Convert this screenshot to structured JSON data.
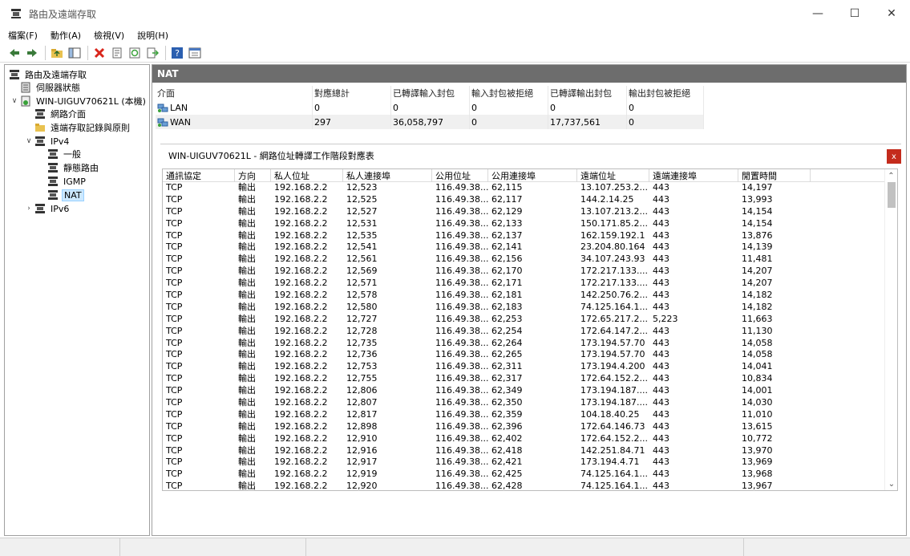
{
  "window": {
    "title": "路由及遠端存取",
    "minimize": "—",
    "maximize": "☐",
    "close": "✕"
  },
  "menu": [
    "檔案(F)",
    "動作(A)",
    "檢視(V)",
    "說明(H)"
  ],
  "tree": [
    {
      "label": "路由及遠端存取",
      "level": 0,
      "exp": "",
      "icon": "server-icon"
    },
    {
      "label": "伺服器狀態",
      "level": 1,
      "exp": "",
      "icon": "server-status-icon"
    },
    {
      "label": "WIN-UIGUV70621L (本機)",
      "level": 1,
      "exp": "∨",
      "icon": "computer-icon"
    },
    {
      "label": "網路介面",
      "level": 2,
      "exp": "",
      "icon": "network-icon"
    },
    {
      "label": "遠端存取記錄與原則",
      "level": 2,
      "exp": "",
      "icon": "folder-icon"
    },
    {
      "label": "IPv4",
      "level": 2,
      "exp": "∨",
      "icon": "network-icon"
    },
    {
      "label": "一般",
      "level": 3,
      "exp": "",
      "icon": "network-icon"
    },
    {
      "label": "靜態路由",
      "level": 3,
      "exp": "",
      "icon": "network-icon"
    },
    {
      "label": "IGMP",
      "level": 3,
      "exp": "",
      "icon": "network-icon"
    },
    {
      "label": "NAT",
      "level": 3,
      "exp": "",
      "icon": "network-icon",
      "selected": true
    },
    {
      "label": "IPv6",
      "level": 2,
      "exp": "›",
      "icon": "network-icon"
    }
  ],
  "nat": {
    "header": "NAT",
    "columns": [
      "介面",
      "對應總計",
      "已轉譯輸入封包",
      "輸入封包被拒絕",
      "已轉譯輸出封包",
      "輸出封包被拒絕"
    ],
    "rows": [
      [
        "LAN",
        "0",
        "0",
        "0",
        "0",
        "0"
      ],
      [
        "WAN",
        "297",
        "36,058,797",
        "0",
        "17,737,561",
        "0"
      ]
    ]
  },
  "mapping": {
    "title": "WIN-UIGUV70621L - 網路位址轉譯工作階段對應表",
    "close": "x",
    "columns": [
      "通訊協定",
      "方向",
      "私人位址",
      "私人連接埠",
      "公用位址",
      "公用連接埠",
      "遠端位址",
      "遠端連接埠",
      "閒置時間"
    ],
    "rows": [
      [
        "TCP",
        "輸出",
        "192.168.2.2",
        "12,523",
        "116.49.38...",
        "62,115",
        "13.107.253.2...",
        "443",
        "14,197"
      ],
      [
        "TCP",
        "輸出",
        "192.168.2.2",
        "12,525",
        "116.49.38...",
        "62,117",
        "144.2.14.25",
        "443",
        "13,993"
      ],
      [
        "TCP",
        "輸出",
        "192.168.2.2",
        "12,527",
        "116.49.38...",
        "62,129",
        "13.107.213.2...",
        "443",
        "14,154"
      ],
      [
        "TCP",
        "輸出",
        "192.168.2.2",
        "12,531",
        "116.49.38...",
        "62,133",
        "150.171.85.2...",
        "443",
        "14,154"
      ],
      [
        "TCP",
        "輸出",
        "192.168.2.2",
        "12,535",
        "116.49.38...",
        "62,137",
        "162.159.192.1",
        "443",
        "13,876"
      ],
      [
        "TCP",
        "輸出",
        "192.168.2.2",
        "12,541",
        "116.49.38...",
        "62,141",
        "23.204.80.164",
        "443",
        "14,139"
      ],
      [
        "TCP",
        "輸出",
        "192.168.2.2",
        "12,561",
        "116.49.38...",
        "62,156",
        "34.107.243.93",
        "443",
        "11,481"
      ],
      [
        "TCP",
        "輸出",
        "192.168.2.2",
        "12,569",
        "116.49.38...",
        "62,170",
        "172.217.133....",
        "443",
        "14,207"
      ],
      [
        "TCP",
        "輸出",
        "192.168.2.2",
        "12,571",
        "116.49.38...",
        "62,171",
        "172.217.133....",
        "443",
        "14,207"
      ],
      [
        "TCP",
        "輸出",
        "192.168.2.2",
        "12,578",
        "116.49.38...",
        "62,181",
        "142.250.76.2...",
        "443",
        "14,182"
      ],
      [
        "TCP",
        "輸出",
        "192.168.2.2",
        "12,580",
        "116.49.38...",
        "62,183",
        "74.125.164.1...",
        "443",
        "14,182"
      ],
      [
        "TCP",
        "輸出",
        "192.168.2.2",
        "12,727",
        "116.49.38...",
        "62,253",
        "172.65.217.2...",
        "5,223",
        "11,663"
      ],
      [
        "TCP",
        "輸出",
        "192.168.2.2",
        "12,728",
        "116.49.38...",
        "62,254",
        "172.64.147.2...",
        "443",
        "11,130"
      ],
      [
        "TCP",
        "輸出",
        "192.168.2.2",
        "12,735",
        "116.49.38...",
        "62,264",
        "173.194.57.70",
        "443",
        "14,058"
      ],
      [
        "TCP",
        "輸出",
        "192.168.2.2",
        "12,736",
        "116.49.38...",
        "62,265",
        "173.194.57.70",
        "443",
        "14,058"
      ],
      [
        "TCP",
        "輸出",
        "192.168.2.2",
        "12,753",
        "116.49.38...",
        "62,311",
        "173.194.4.200",
        "443",
        "14,041"
      ],
      [
        "TCP",
        "輸出",
        "192.168.2.2",
        "12,755",
        "116.49.38...",
        "62,317",
        "172.64.152.2...",
        "443",
        "10,834"
      ],
      [
        "TCP",
        "輸出",
        "192.168.2.2",
        "12,806",
        "116.49.38...",
        "62,349",
        "173.194.187....",
        "443",
        "14,001"
      ],
      [
        "TCP",
        "輸出",
        "192.168.2.2",
        "12,807",
        "116.49.38...",
        "62,350",
        "173.194.187....",
        "443",
        "14,030"
      ],
      [
        "TCP",
        "輸出",
        "192.168.2.2",
        "12,817",
        "116.49.38...",
        "62,359",
        "104.18.40.25",
        "443",
        "11,010"
      ],
      [
        "TCP",
        "輸出",
        "192.168.2.2",
        "12,898",
        "116.49.38...",
        "62,396",
        "172.64.146.73",
        "443",
        "13,615"
      ],
      [
        "TCP",
        "輸出",
        "192.168.2.2",
        "12,910",
        "116.49.38...",
        "62,402",
        "172.64.152.2...",
        "443",
        "10,772"
      ],
      [
        "TCP",
        "輸出",
        "192.168.2.2",
        "12,916",
        "116.49.38...",
        "62,418",
        "142.251.84.71",
        "443",
        "13,970"
      ],
      [
        "TCP",
        "輸出",
        "192.168.2.2",
        "12,917",
        "116.49.38...",
        "62,421",
        "173.194.4.71",
        "443",
        "13,969"
      ],
      [
        "TCP",
        "輸出",
        "192.168.2.2",
        "12,919",
        "116.49.38...",
        "62,425",
        "74.125.164.1...",
        "443",
        "13,968"
      ],
      [
        "TCP",
        "輸出",
        "192.168.2.2",
        "12,920",
        "116.49.38...",
        "62,428",
        "74.125.164.1...",
        "443",
        "13,967"
      ]
    ]
  },
  "colors": {
    "nat_header": "#6d6d6d",
    "selection": "#cce8ff",
    "close_red": "#c42b1c",
    "icon_blue": "#1f5fa8",
    "icon_green": "#3aa13a",
    "icon_red": "#d9261c"
  }
}
